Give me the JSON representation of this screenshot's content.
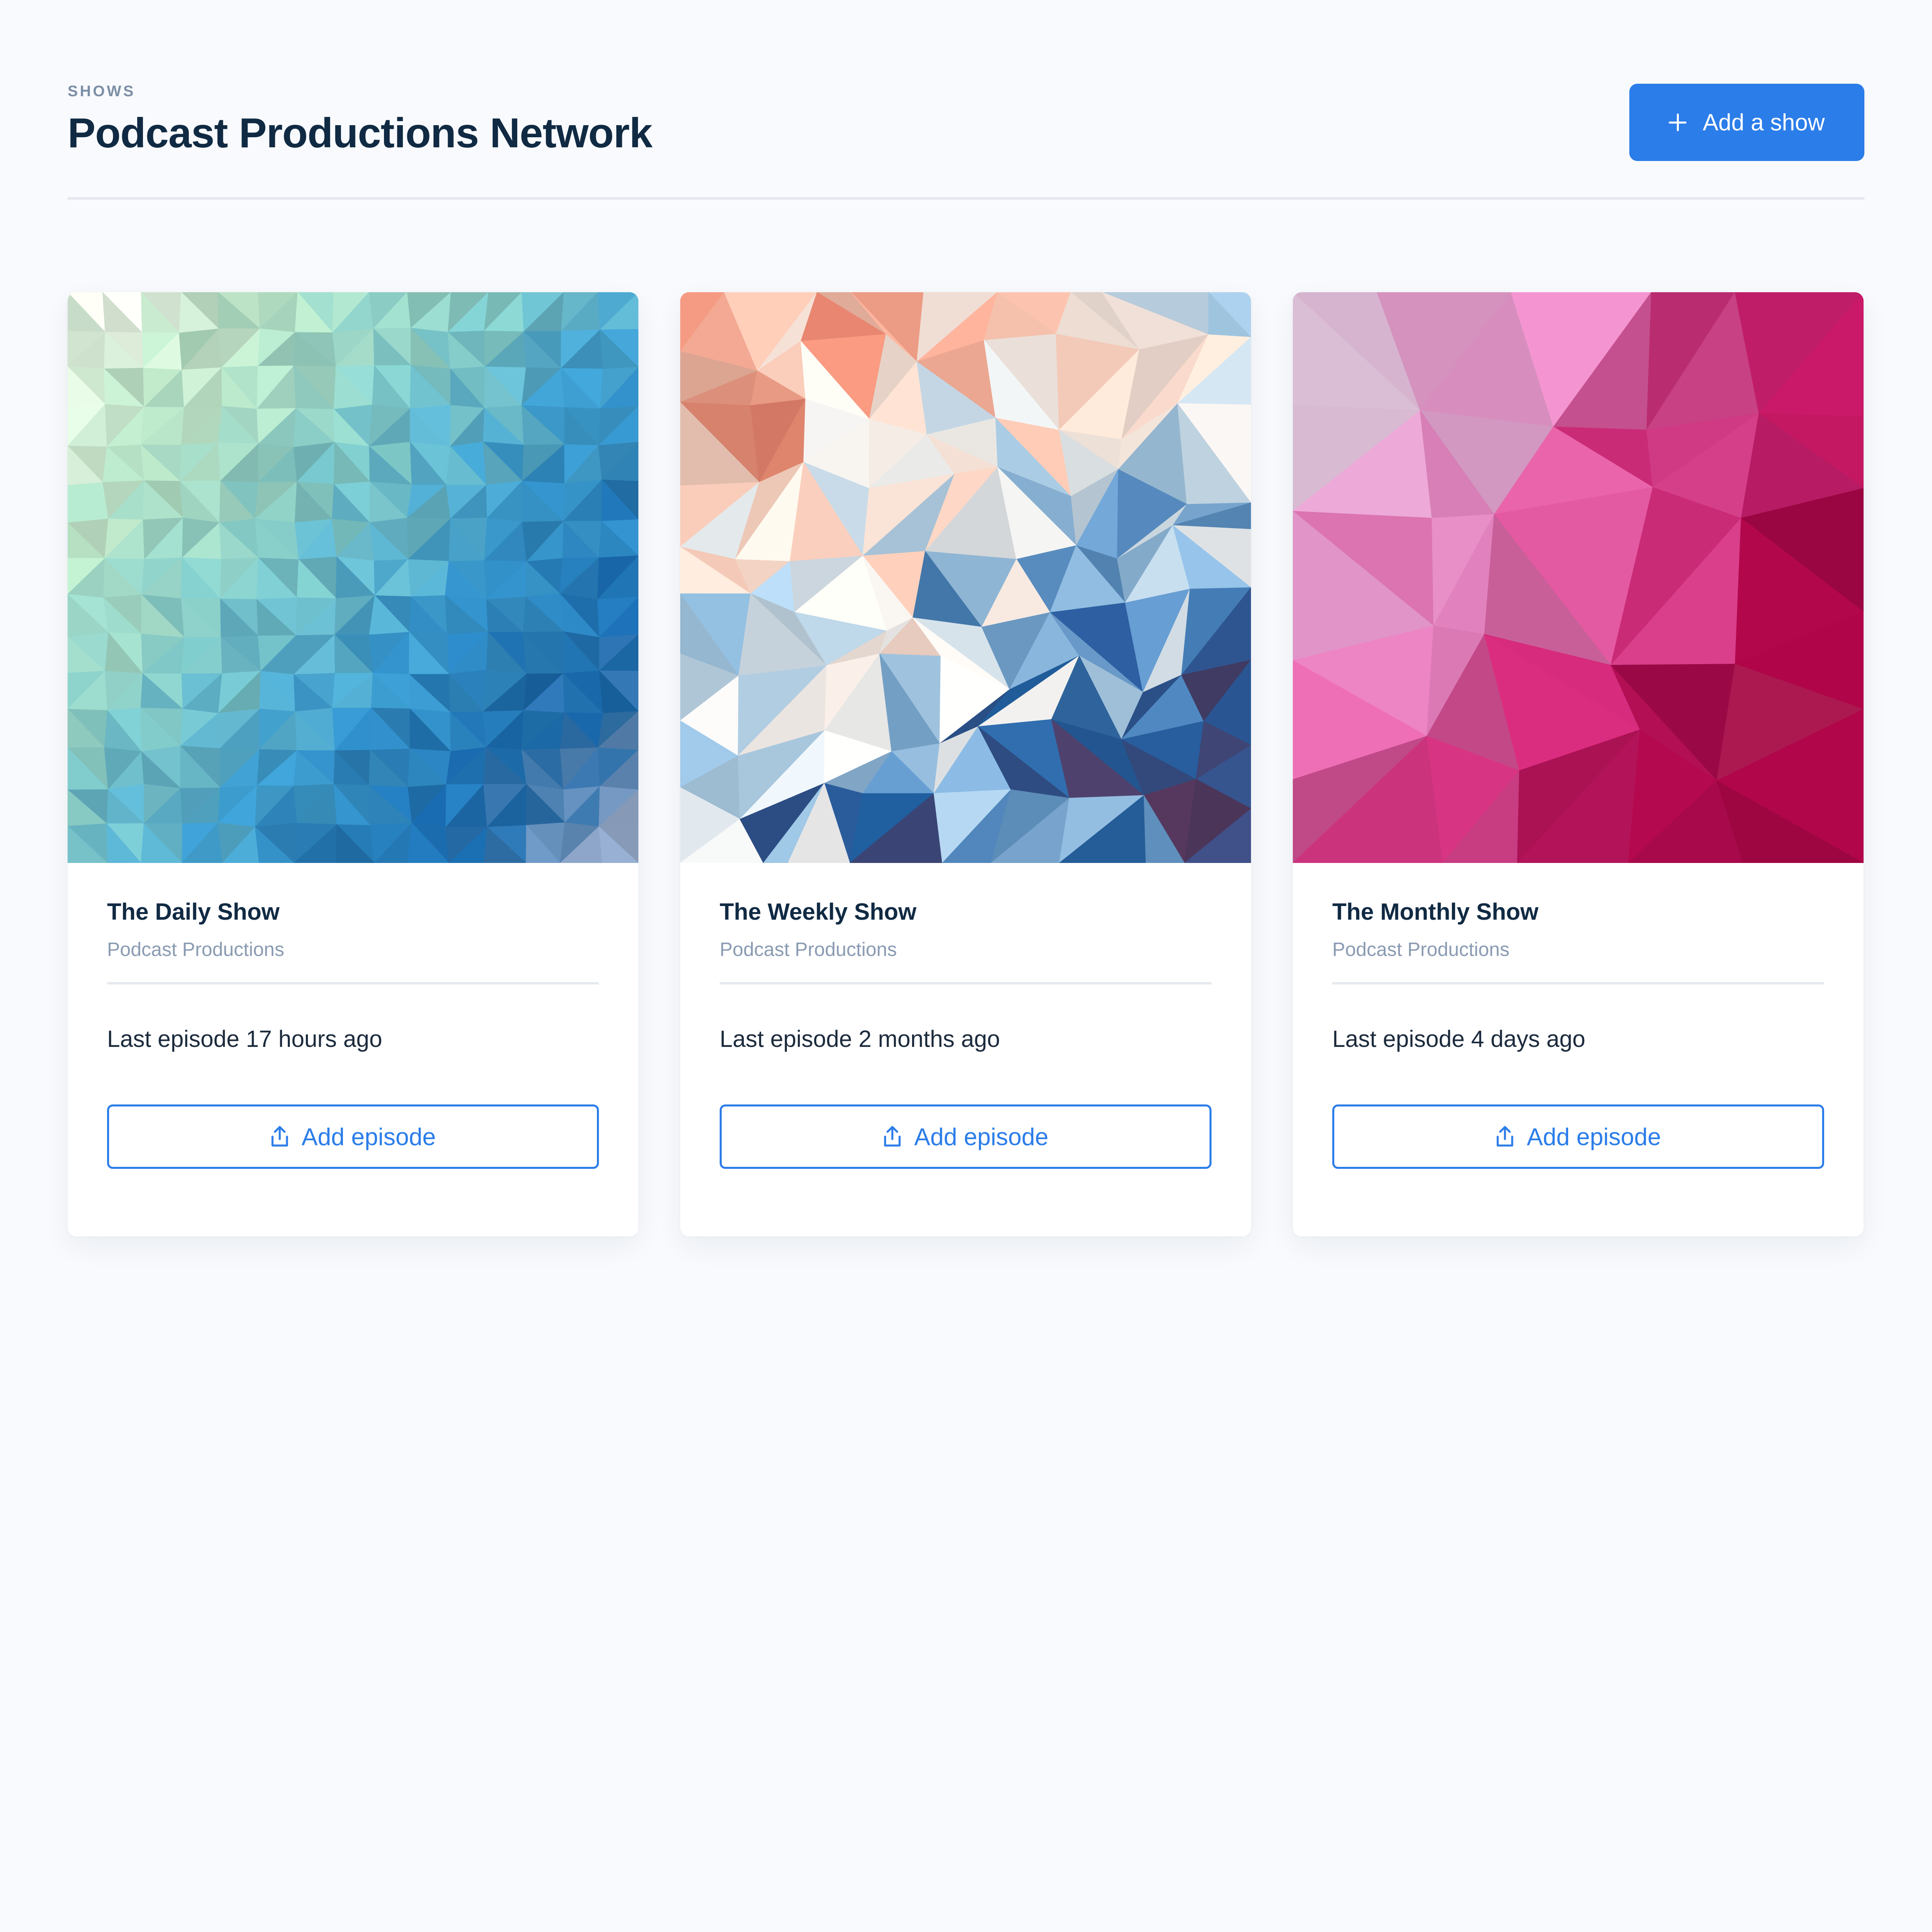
{
  "header": {
    "eyebrow": "SHOWS",
    "title": "Podcast Productions Network",
    "add_show_label": "Add a show"
  },
  "colors": {
    "accent": "#2b7de9",
    "background": "#f8fafd",
    "title": "#102a43",
    "muted": "#8a9bb2"
  },
  "shows": [
    {
      "title": "The Daily Show",
      "network": "Podcast Productions",
      "last_episode": "Last episode 17 hours ago",
      "add_episode_label": "Add episode",
      "cover_palette": [
        "#f0f8e8",
        "#b6e0c2",
        "#7fc6c4",
        "#3c9acb",
        "#1766a8",
        "#8fa3c2"
      ]
    },
    {
      "title": "The Weekly Show",
      "network": "Podcast Productions",
      "last_episode": "Last episode 2 months ago",
      "add_episode_label": "Add episode",
      "cover_palette": [
        "#a32032",
        "#e38770",
        "#f6c8b5",
        "#f7efe8",
        "#9fc5e2",
        "#1f5ea0",
        "#5e3050"
      ]
    },
    {
      "title": "The Monthly Show",
      "network": "Podcast Productions",
      "last_episode": "Last episode 4 days ago",
      "add_episode_label": "Add episode",
      "cover_palette": [
        "#f3eef5",
        "#e3b6da",
        "#e07bb8",
        "#c8206e",
        "#9e0340",
        "#c98090"
      ]
    }
  ]
}
